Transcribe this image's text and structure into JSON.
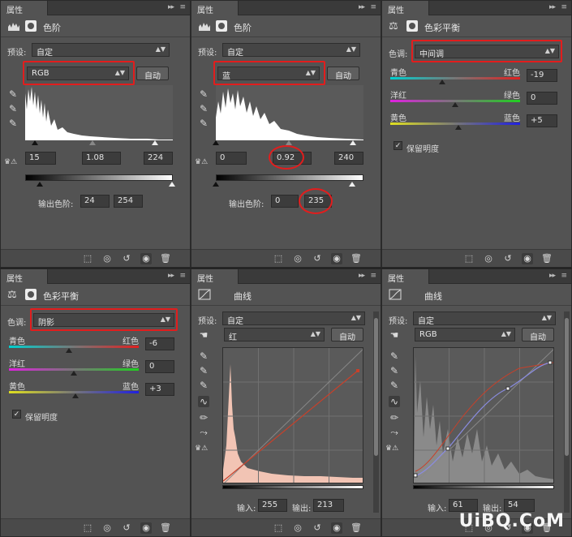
{
  "common": {
    "tab_label": "属性",
    "preset_label": "预设:",
    "preset_value": "自定",
    "auto_label": "自动",
    "output_levels_label": "输出色阶:",
    "tone_label": "色调:",
    "cyan": "青色",
    "red": "红色",
    "magenta": "洋红",
    "green": "绿色",
    "yellow": "黄色",
    "blue": "蓝色",
    "preserve_luminosity": "保留明度",
    "input_label": "输入:",
    "output_label": "输出:"
  },
  "levels1": {
    "title": "色阶",
    "channel": "RGB",
    "input_black": "15",
    "input_gamma": "1.08",
    "input_white": "224",
    "output_black": "24",
    "output_white": "254"
  },
  "levels2": {
    "title": "色阶",
    "channel": "蓝",
    "input_black": "0",
    "input_gamma": "0.92",
    "input_white": "240",
    "output_black": "0",
    "output_white": "235"
  },
  "balance1": {
    "title": "色彩平衡",
    "tone": "中间调",
    "cyan_red": "-19",
    "magenta_green": "0",
    "yellow_blue": "+5"
  },
  "balance2": {
    "title": "色彩平衡",
    "tone": "阴影",
    "cyan_red": "-6",
    "magenta_green": "0",
    "yellow_blue": "+3"
  },
  "curves1": {
    "title": "曲线",
    "channel": "红",
    "input": "255",
    "output": "213"
  },
  "curves2": {
    "title": "曲线",
    "channel": "RGB",
    "input": "61",
    "output": "54"
  },
  "colors": {
    "annotation": "#e21d1d",
    "panel_bg": "#535353",
    "red_curve": "#c8402a",
    "blue_curve": "#8a8ce0"
  },
  "watermark": "UiBQ.CoM"
}
